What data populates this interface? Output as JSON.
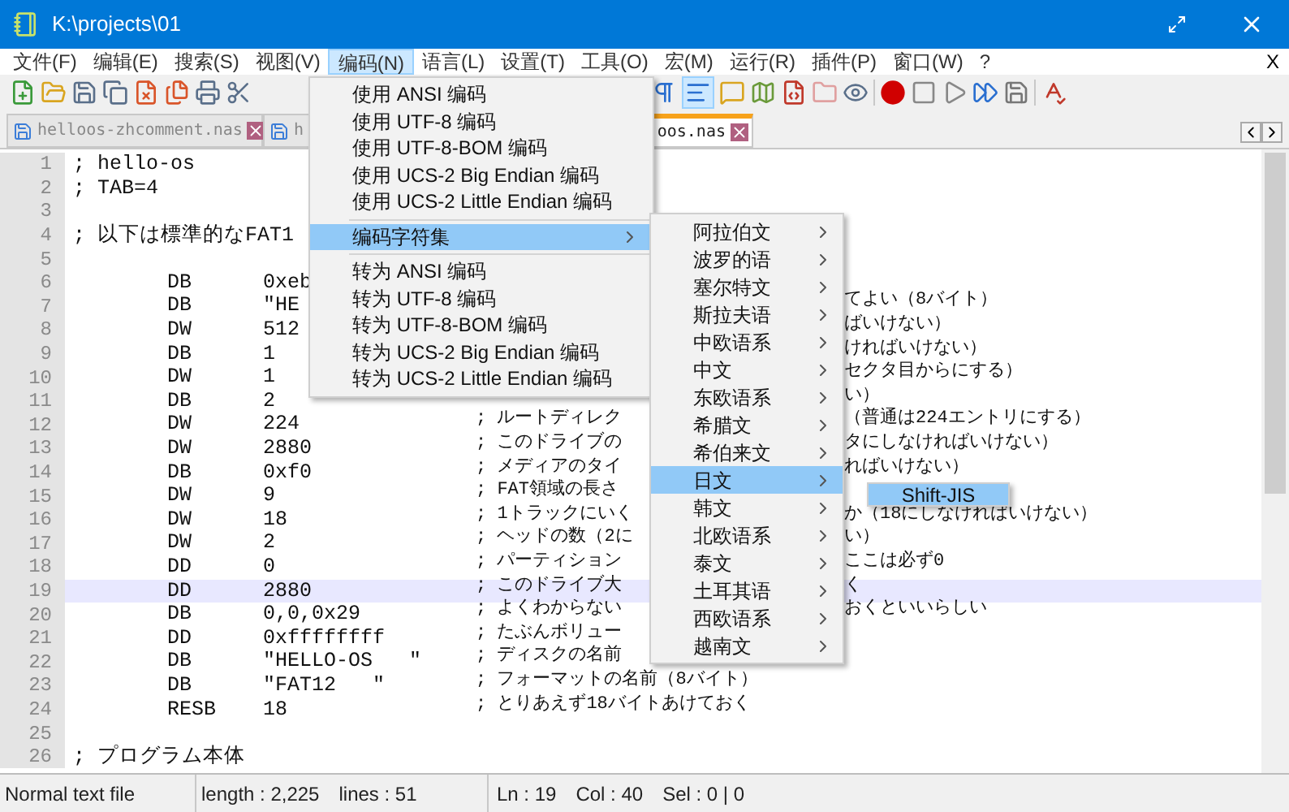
{
  "window": {
    "title": "K:\\projects\\01"
  },
  "menubar": [
    {
      "label": "文件(F)",
      "selected": false
    },
    {
      "label": "编辑(E)",
      "selected": false
    },
    {
      "label": "搜索(S)",
      "selected": false
    },
    {
      "label": "视图(V)",
      "selected": false
    },
    {
      "label": "编码(N)",
      "selected": true
    },
    {
      "label": "语言(L)",
      "selected": false
    },
    {
      "label": "设置(T)",
      "selected": false
    },
    {
      "label": "工具(O)",
      "selected": false
    },
    {
      "label": "宏(M)",
      "selected": false
    },
    {
      "label": "运行(R)",
      "selected": false
    },
    {
      "label": "插件(P)",
      "selected": false
    },
    {
      "label": "窗口(W)",
      "selected": false
    },
    {
      "label": "?",
      "selected": false
    }
  ],
  "menubar_close": "X",
  "tabs": [
    {
      "label": "helloos-zhcomment.nas",
      "selected": false
    },
    {
      "label": "h",
      "selected": false
    },
    {
      "label": "oos.nas",
      "selected": true
    }
  ],
  "editor": {
    "lines": [
      {
        "n": "1",
        "kind": "text",
        "text": "; hello-os",
        "current": false
      },
      {
        "n": "2",
        "kind": "text",
        "text": "; TAB=4",
        "current": false
      },
      {
        "n": "3",
        "kind": "blank",
        "current": false
      },
      {
        "n": "4",
        "kind": "text",
        "text": "; 以下は標準的なFAT1",
        "current": false
      },
      {
        "n": "5",
        "kind": "blank",
        "current": false
      },
      {
        "n": "6",
        "kind": "code",
        "instr": "DB",
        "operand": "0xeb",
        "current": false
      },
      {
        "n": "7",
        "kind": "code",
        "instr": "DB",
        "operand": "\"HE",
        "comment_right": "てよい（8バイト）",
        "current": false
      },
      {
        "n": "8",
        "kind": "code",
        "instr": "DW",
        "operand": "512",
        "comment_right": "ばいけない）",
        "current": false
      },
      {
        "n": "9",
        "kind": "code",
        "instr": "DB",
        "operand": "1",
        "comment_right": "ければいけない）",
        "current": false
      },
      {
        "n": "10",
        "kind": "code",
        "instr": "DW",
        "operand": "1",
        "comment_right": "セクタ目からにする）",
        "current": false
      },
      {
        "n": "11",
        "kind": "code",
        "instr": "DB",
        "operand": "2",
        "comment_right": "い）",
        "current": false
      },
      {
        "n": "12",
        "kind": "code",
        "instr": "DW",
        "operand": "224",
        "comment": "; ルートディレク",
        "comment_right": "（普通は224エントリにする）",
        "current": false
      },
      {
        "n": "13",
        "kind": "code",
        "instr": "DW",
        "operand": "2880",
        "comment": "; このドライブの",
        "comment_right": "タにしなければいけない）",
        "current": false
      },
      {
        "n": "14",
        "kind": "code",
        "instr": "DB",
        "operand": "0xf0",
        "comment": "; メディアのタイ",
        "comment_right": "ればいけない）",
        "current": false
      },
      {
        "n": "15",
        "kind": "code",
        "instr": "DW",
        "operand": "9",
        "comment": "; FAT領域の長さ",
        "current": false
      },
      {
        "n": "16",
        "kind": "code",
        "instr": "DW",
        "operand": "18",
        "comment": "; 1トラックにいく",
        "comment_right": "か（18にしなければいけない）",
        "current": false
      },
      {
        "n": "17",
        "kind": "code",
        "instr": "DW",
        "operand": "2",
        "comment": "; ヘッドの数（2に",
        "comment_right": "い）",
        "current": false
      },
      {
        "n": "18",
        "kind": "code",
        "instr": "DD",
        "operand": "0",
        "comment": "; パーティション",
        "comment_right": "ここは必ず0",
        "current": false
      },
      {
        "n": "19",
        "kind": "code",
        "instr": "DD",
        "operand": "2880",
        "comment": "; このドライブ大",
        "comment_right": "く",
        "current": true
      },
      {
        "n": "20",
        "kind": "code",
        "instr": "DB",
        "operand": "0,0,0x29",
        "comment": "; よくわからない",
        "comment_right": "おくといいらしい",
        "current": false
      },
      {
        "n": "21",
        "kind": "code",
        "instr": "DD",
        "operand": "0xffffffff",
        "comment": "; たぶんボリュー",
        "current": false
      },
      {
        "n": "22",
        "kind": "code",
        "instr": "DB",
        "operand": "\"HELLO-OS   \"",
        "comment": "; ディスクの名前",
        "current": false
      },
      {
        "n": "23",
        "kind": "code",
        "instr": "DB",
        "operand": "\"FAT12   \"",
        "comment": "; フォーマットの名前（8バイト）",
        "current": false
      },
      {
        "n": "24",
        "kind": "code",
        "instr": "RESB",
        "operand": "18",
        "comment": "; とりあえず18バイトあけておく",
        "current": false
      },
      {
        "n": "25",
        "kind": "blank",
        "current": false
      },
      {
        "n": "26",
        "kind": "text",
        "text": "; プログラム本体",
        "current": false
      }
    ]
  },
  "encoding_menu": [
    {
      "kind": "item",
      "label": "使用 ANSI 编码",
      "selected": false
    },
    {
      "kind": "item",
      "label": "使用 UTF-8 编码",
      "selected": false
    },
    {
      "kind": "item",
      "label": "使用 UTF-8-BOM 编码",
      "selected": false
    },
    {
      "kind": "item",
      "label": "使用 UCS-2 Big Endian 编码",
      "selected": false
    },
    {
      "kind": "item",
      "label": "使用 UCS-2 Little Endian 编码",
      "selected": false
    },
    {
      "kind": "separator"
    },
    {
      "kind": "submenu",
      "label": "编码字符集",
      "selected": true
    },
    {
      "kind": "separator"
    },
    {
      "kind": "item",
      "label": "转为 ANSI 编码",
      "selected": false
    },
    {
      "kind": "item",
      "label": "转为 UTF-8 编码",
      "selected": false
    },
    {
      "kind": "item",
      "label": "转为 UTF-8-BOM 编码",
      "selected": false
    },
    {
      "kind": "item",
      "label": "转为 UCS-2 Big Endian 编码",
      "selected": false
    },
    {
      "kind": "item",
      "label": "转为 UCS-2 Little Endian 编码",
      "selected": false
    }
  ],
  "charset_submenu": [
    {
      "label": "阿拉伯文",
      "selected": false
    },
    {
      "label": "波罗的语",
      "selected": false
    },
    {
      "label": "塞尔特文",
      "selected": false
    },
    {
      "label": "斯拉夫语",
      "selected": false
    },
    {
      "label": "中欧语系",
      "selected": false
    },
    {
      "label": "中文",
      "selected": false
    },
    {
      "label": "东欧语系",
      "selected": false
    },
    {
      "label": "希腊文",
      "selected": false
    },
    {
      "label": "希伯来文",
      "selected": false
    },
    {
      "label": "日文",
      "selected": true
    },
    {
      "label": "韩文",
      "selected": false
    },
    {
      "label": "北欧语系",
      "selected": false
    },
    {
      "label": "泰文",
      "selected": false
    },
    {
      "label": "土耳其语",
      "selected": false
    },
    {
      "label": "西欧语系",
      "selected": false
    },
    {
      "label": "越南文",
      "selected": false
    }
  ],
  "japanese_submenu": [
    {
      "label": "Shift-JIS",
      "selected": true
    }
  ],
  "status_bar": {
    "file_type": "Normal text file",
    "length": "length : 2,225",
    "lines": "lines : 51",
    "ln": "Ln : 19",
    "col": "Col : 40",
    "sel": "Sel : 0 | 0"
  }
}
